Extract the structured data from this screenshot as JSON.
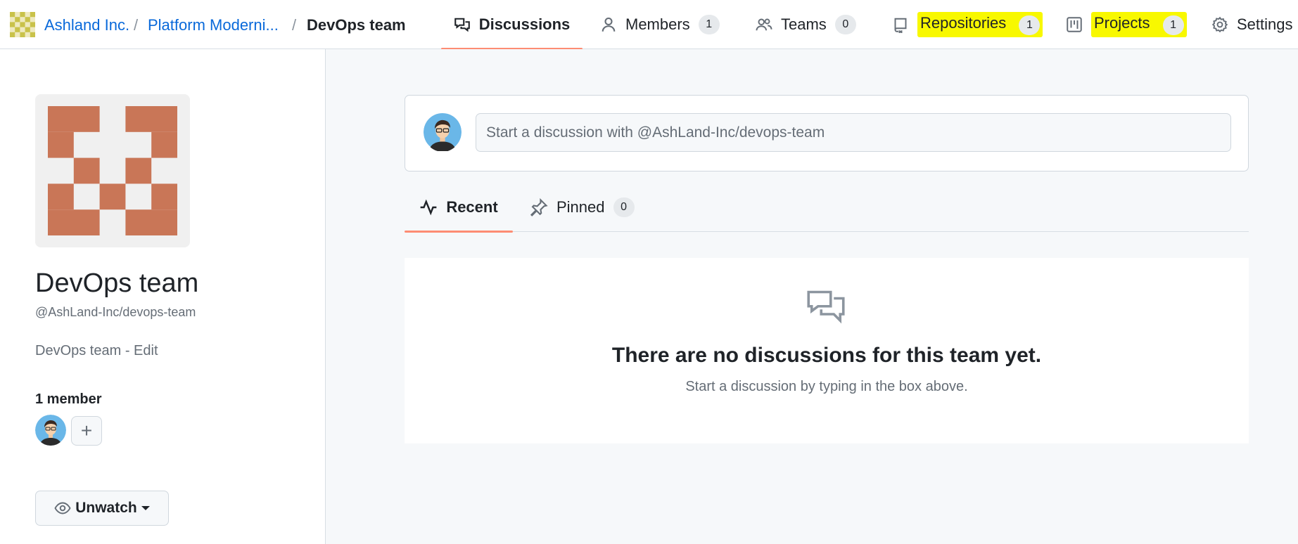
{
  "breadcrumb": {
    "org": "Ashland Inc.",
    "separator": "/",
    "project": "Platform Moderni...",
    "team": "DevOps team"
  },
  "nav": {
    "discussions": {
      "label": "Discussions"
    },
    "members": {
      "label": "Members",
      "count": "1"
    },
    "teams": {
      "label": "Teams",
      "count": "0"
    },
    "repositories": {
      "label": "Repositories",
      "count": "1"
    },
    "projects": {
      "label": "Projects",
      "count": "1"
    },
    "settings": {
      "label": "Settings"
    }
  },
  "sidebar": {
    "team_name": "DevOps team",
    "team_handle": "@AshLand-Inc/devops-team",
    "description": "DevOps team",
    "desc_separator": " - ",
    "edit_label": "Edit",
    "members_heading": "1 member",
    "add_member_label": "+",
    "unwatch_label": "Unwatch"
  },
  "composer": {
    "placeholder": "Start a discussion with @AshLand-Inc/devops-team"
  },
  "subtabs": {
    "recent": {
      "label": "Recent"
    },
    "pinned": {
      "label": "Pinned",
      "count": "0"
    }
  },
  "blankslate": {
    "title": "There are no discussions for this team yet.",
    "subtitle": "Start a discussion by typing in the box above."
  },
  "colors": {
    "accent_underline": "#fd8c73",
    "link": "#0969da",
    "highlight": "#f8f800",
    "team_avatar": "#c97657"
  },
  "icons": {
    "discussions": "comment-discussion-icon",
    "members": "person-icon",
    "teams": "people-icon",
    "repositories": "repo-icon",
    "projects": "project-icon",
    "settings": "gear-icon",
    "recent": "pulse-icon",
    "pinned": "pin-icon",
    "watch": "eye-icon"
  }
}
